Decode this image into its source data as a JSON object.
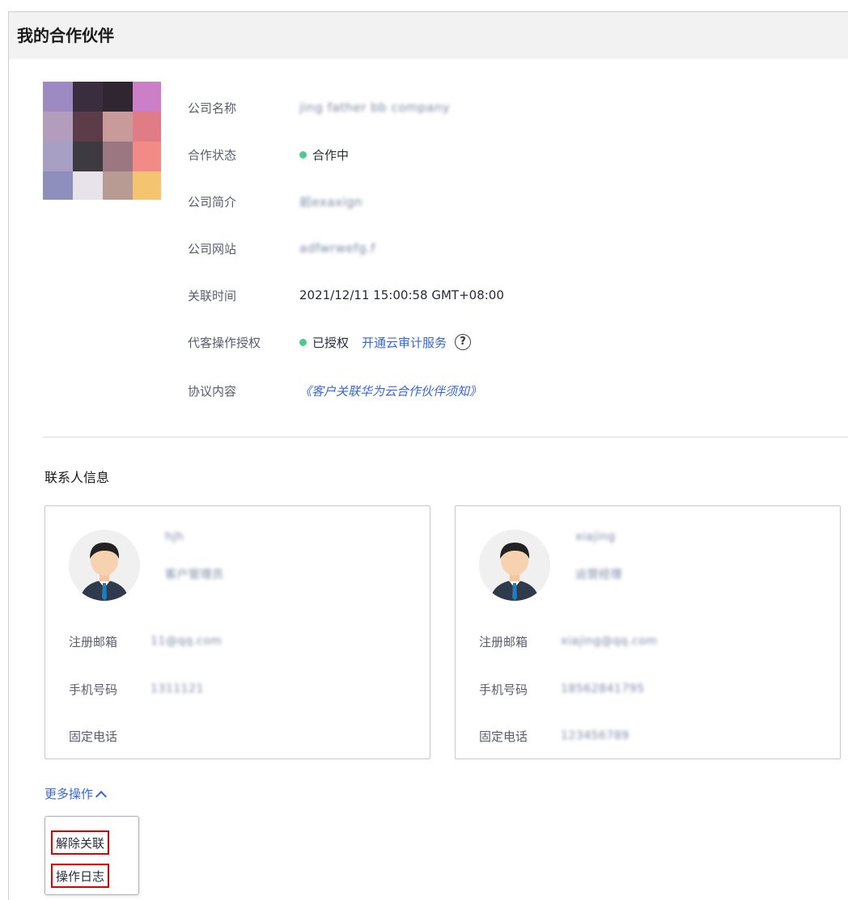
{
  "page": {
    "title": "我的合作伙伴"
  },
  "company": {
    "fields": [
      {
        "label": "公司名称",
        "value": "jing father bb company"
      },
      {
        "label": "合作状态",
        "value": "合作中"
      },
      {
        "label": "公司简介",
        "value": "前exaxign"
      },
      {
        "label": "公司网站",
        "value": "adfwrwefg.f"
      },
      {
        "label": "关联时间",
        "value": "2021/12/11 15:00:58 GMT+08:00"
      },
      {
        "label": "代客操作授权",
        "value": "已授权",
        "link": "开通云审计服务"
      },
      {
        "label": "协议内容",
        "value": "《客户关联华为云合作伙伴须知》"
      }
    ]
  },
  "contacts": {
    "section_title": "联系人信息",
    "items": [
      {
        "name": "hjh",
        "role": "客户管理员",
        "email": "11@qq.com",
        "phone": "1311121",
        "landline": ""
      },
      {
        "name": "xiajing",
        "role": "运营经理",
        "email": "xiajing@qq.com",
        "phone": "18562841795",
        "landline": "123456789"
      }
    ],
    "labels": {
      "email": "注册邮箱",
      "phone": "手机号码",
      "landline": "固定电话"
    }
  },
  "more": {
    "label": "更多操作",
    "menu": [
      "解除关联",
      "操作日志"
    ]
  },
  "colors": {
    "status_dot": "#4ccb8f",
    "link": "#3767d6",
    "highlight": "#e00000"
  }
}
